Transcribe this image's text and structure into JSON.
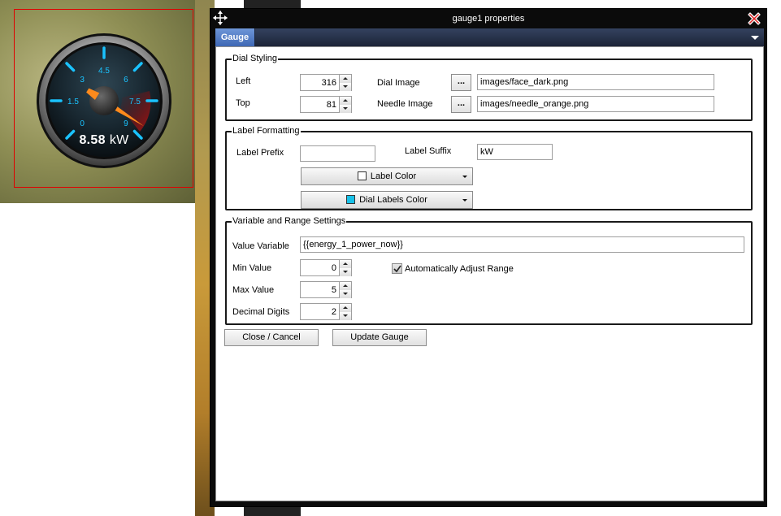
{
  "gauge": {
    "value": "8.58",
    "unit": "kW",
    "scale_labels": [
      "0",
      "1.5",
      "3",
      "4.5",
      "6",
      "7.5",
      "9"
    ],
    "needle_value": 8.58,
    "scale_max": 9,
    "needle_color": "#ff8a1c",
    "tick_color": "#1ac3ff"
  },
  "dialog": {
    "title": "gauge1 properties",
    "move_icon": "move-arrows-icon",
    "close_icon": "close-x-icon"
  },
  "tabs": [
    {
      "label": "Gauge",
      "active": true
    }
  ],
  "dial_styling": {
    "legend": "Dial Styling",
    "left_label": "Left",
    "left_value": "316",
    "top_label": "Top",
    "top_value": "81",
    "dial_image_label": "Dial Image",
    "dial_image_button": "...",
    "dial_image_value": "images/face_dark.png",
    "needle_image_label": "Needle Image",
    "needle_image_button": "...",
    "needle_image_value": "images/needle_orange.png"
  },
  "label_formatting": {
    "legend": "Label Formatting",
    "prefix_label": "Label Prefix",
    "prefix_value": "",
    "suffix_label": "Label Suffix",
    "suffix_value": "kW",
    "label_color_button": "Label Color",
    "label_color": "#ffffff",
    "dial_labels_color_button": "Dial Labels Color",
    "dial_labels_color": "#17c1e8"
  },
  "variable_range": {
    "legend": "Variable and Range Settings",
    "value_variable_label": "Value Variable",
    "value_variable_value": "{{energy_1_power_now}}",
    "min_label": "Min Value",
    "min_value": "0",
    "max_label": "Max Value",
    "max_value": "5",
    "decimal_label": "Decimal Digits",
    "decimal_value": "2",
    "auto_adjust_label": "Automatically Adjust Range",
    "auto_adjust_checked": true
  },
  "actions": {
    "close_cancel": "Close / Cancel",
    "update_gauge": "Update Gauge"
  }
}
